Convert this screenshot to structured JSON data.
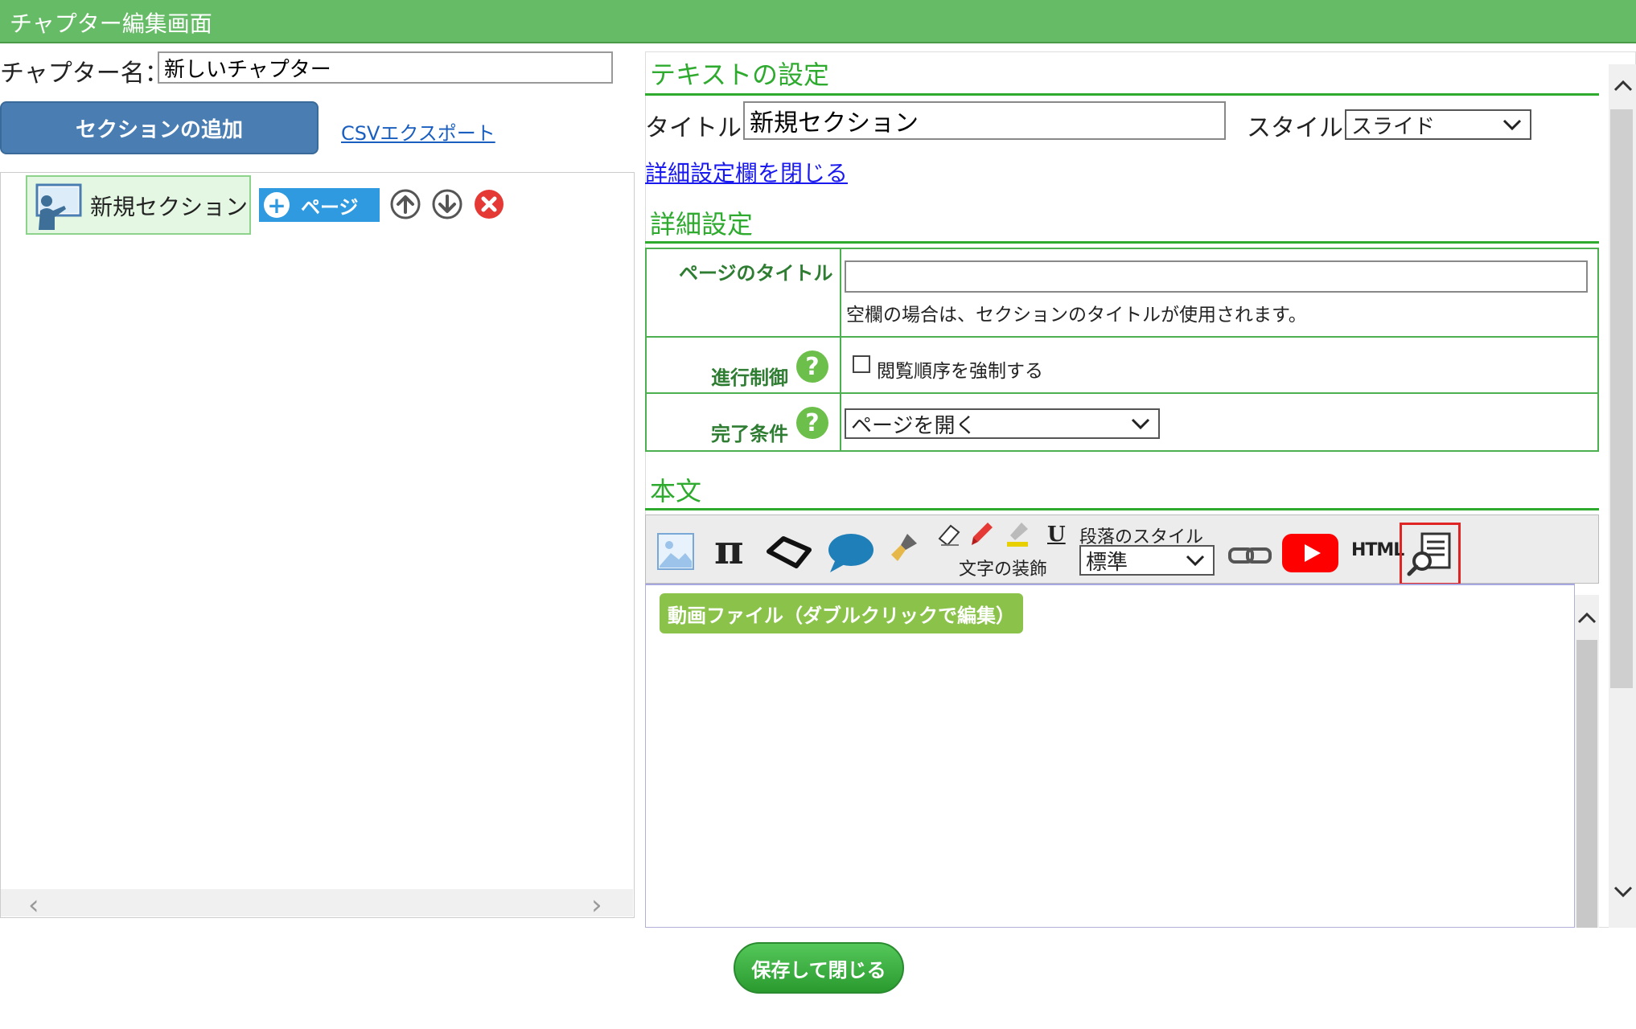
{
  "window": {
    "title": "チャプター編集画面"
  },
  "chapter": {
    "label": "チャプター名：",
    "name_value": "新しいチャプター"
  },
  "left": {
    "add_section_label": "セクションの追加",
    "csv_export_label": "CSVエクスポート",
    "tree": [
      {
        "label": "新規セクション",
        "page_button_label": "ページ"
      }
    ]
  },
  "text_settings": {
    "heading": "テキストの設定",
    "title_label": "タイトル:",
    "title_value": "新規セクション",
    "style_label": "スタイル:",
    "style_value": "スライド",
    "close_details_link": "詳細設定欄を閉じる"
  },
  "details": {
    "heading": "詳細設定",
    "page_title_label": "ページのタイトル",
    "page_title_value": "",
    "page_title_note": "空欄の場合は、セクションのタイトルが使用されます。",
    "progress_label": "進行制御",
    "progress_checkbox_label": "閲覧順序を強制する",
    "progress_checked": false,
    "completion_label": "完了条件",
    "completion_value": "ページを開く",
    "help_glyph": "?"
  },
  "body": {
    "heading": "本文",
    "toolbar": {
      "text_decoration_label": "文字の装飾",
      "paragraph_style_label": "段落のスタイル",
      "paragraph_style_value": "標準",
      "underline_glyph": "U",
      "html_label": "HTML",
      "pi_glyph": "π",
      "icons": [
        "image-icon",
        "pi-icon",
        "shape-icon",
        "speech-bubble-icon",
        "brush-icon",
        "eraser-icon",
        "marker-icon",
        "highlighter-icon",
        "underline-icon",
        "link-icon",
        "youtube-icon",
        "html-icon",
        "preview-icon"
      ]
    },
    "video_chip_label": "動画ファイル（ダブルクリックで編集）"
  },
  "footer": {
    "save_close_label": "保存して閉じる"
  },
  "colors": {
    "header_green": "#66bb66",
    "accent_green": "#2eaa2e",
    "button_blue": "#4a7eb3",
    "page_blue": "#2f9ae0",
    "delete_red": "#e53935",
    "highlight_red": "#e02424"
  }
}
